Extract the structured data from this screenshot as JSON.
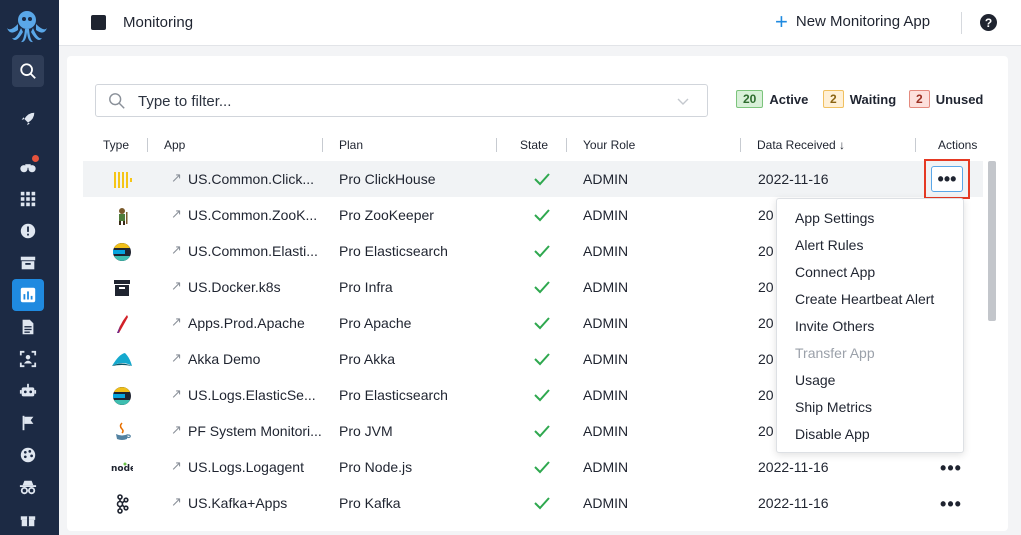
{
  "header": {
    "title": "Monitoring",
    "new_app_label": "New Monitoring App",
    "help_label": "?"
  },
  "filter": {
    "placeholder": "Type to filter..."
  },
  "counts": {
    "active": {
      "count": "20",
      "label": "Active"
    },
    "waiting": {
      "count": "2",
      "label": "Waiting"
    },
    "unused": {
      "count": "2",
      "label": "Unused"
    }
  },
  "table": {
    "columns": {
      "type": "Type",
      "app": "App",
      "plan": "Plan",
      "state": "State",
      "role": "Your Role",
      "data_received": "Data Received ↓",
      "actions": "Actions"
    },
    "rows": [
      {
        "icon": "clickhouse-icon",
        "app": "US.Common.ClickHouse",
        "plan": "Pro ClickHouse",
        "role": "ADMIN",
        "date": "2022-11-16"
      },
      {
        "icon": "zookeeper-icon",
        "app": "US.Common.ZooKeeper",
        "plan": "Pro ZooKeeper",
        "role": "ADMIN",
        "date": "20"
      },
      {
        "icon": "elasticsearch-icon",
        "app": "US.Common.Elasticsearch",
        "plan": "Pro Elasticsearch",
        "role": "ADMIN",
        "date": "20"
      },
      {
        "icon": "infra-icon",
        "app": "US.Docker.k8s",
        "plan": "Pro Infra",
        "role": "ADMIN",
        "date": "20"
      },
      {
        "icon": "apache-icon",
        "app": "Apps.Prod.Apache",
        "plan": "Pro Apache",
        "role": "ADMIN",
        "date": "20"
      },
      {
        "icon": "akka-icon",
        "app": "Akka Demo",
        "plan": "Pro Akka",
        "role": "ADMIN",
        "date": "20"
      },
      {
        "icon": "elasticsearch-icon",
        "app": "US.Logs.ElasticSearch",
        "plan": "Pro Elasticsearch",
        "role": "ADMIN",
        "date": "20"
      },
      {
        "icon": "java-icon",
        "app": "PF System Monitoring",
        "plan": "Pro JVM",
        "role": "ADMIN",
        "date": "20"
      },
      {
        "icon": "nodejs-icon",
        "app": "US.Logs.Logagent",
        "plan": "Pro Node.js",
        "role": "ADMIN",
        "date": "2022-11-16"
      },
      {
        "icon": "kafka-icon",
        "app": "US.Kafka+Apps",
        "plan": "Pro Kafka",
        "role": "ADMIN",
        "date": "2022-11-16"
      }
    ],
    "more_label": "•••"
  },
  "menu": {
    "items": [
      {
        "label": "App Settings"
      },
      {
        "label": "Alert Rules"
      },
      {
        "label": "Connect App"
      },
      {
        "label": "Create Heartbeat Alert"
      },
      {
        "label": "Invite Others"
      },
      {
        "label": "Transfer App"
      },
      {
        "label": "Usage"
      },
      {
        "label": "Ship Metrics"
      },
      {
        "label": "Disable App"
      }
    ]
  },
  "colors": {
    "sidebar": "#1c2a44",
    "accent": "#1f8ae0",
    "check": "#2fa84f",
    "highlight": "#e53923"
  }
}
